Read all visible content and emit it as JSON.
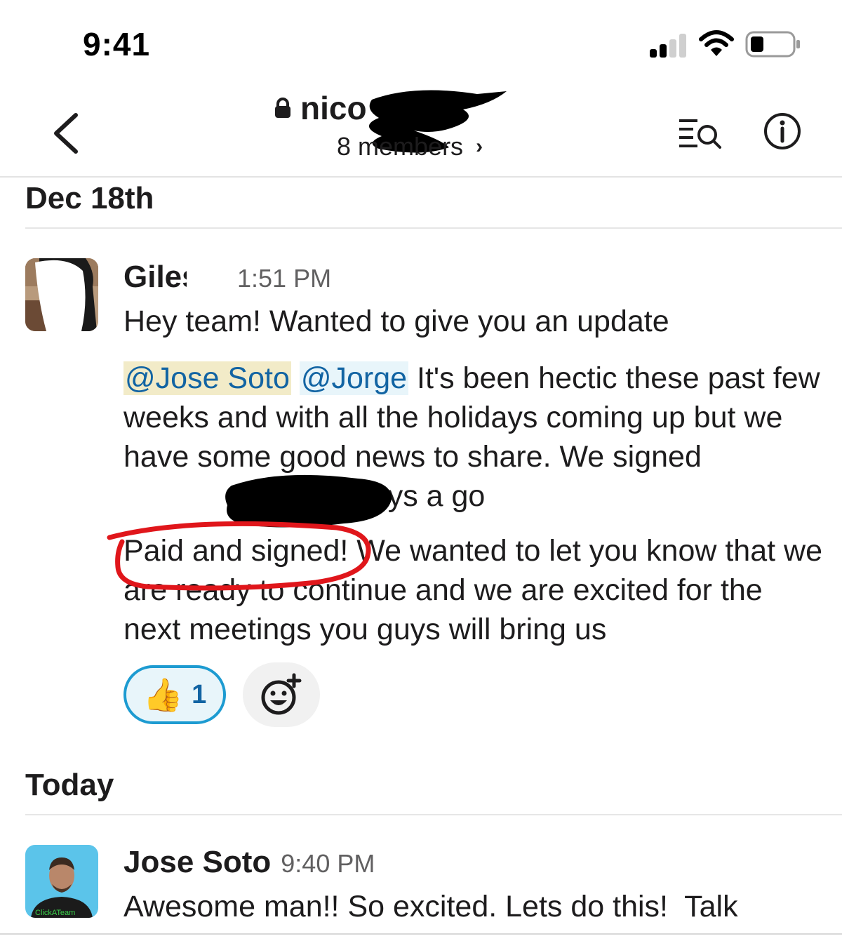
{
  "status_bar": {
    "time": "9:41"
  },
  "header": {
    "channel_name": "nico",
    "members_label": "8 members",
    "members_chevron": "›"
  },
  "sections": {
    "first_date": "Dec 18th",
    "second_date": "Today"
  },
  "messages": [
    {
      "author": "Giles",
      "time": "1:51 PM",
      "line1": "Hey team! Wanted to give you an update",
      "mention1": "@Jose Soto",
      "mention2": "@Jorge",
      "para2_after_mentions": " It's been hectic these past few weeks and with all the holidays coming up but we have some good news to share. We signed ",
      "para2_end": "two days a go",
      "para3": "Paid and signed! We wanted to let you know that we are ready to continue and we are excited for the next meetings you guys will bring us",
      "reaction_emoji": "👍",
      "reaction_count": "1"
    },
    {
      "author": "Jose Soto",
      "time": "9:40 PM",
      "text": "Awesome man!! So excited. Lets do this!  Talk",
      "avatar_shirt_text": "ClickATeam"
    }
  ],
  "colors": {
    "mention_text": "#1264a3",
    "reaction_border": "#1d9bd1",
    "annotation_circle": "#e0161b"
  },
  "icons": [
    "chevron-left-icon",
    "lock-icon",
    "search-icon",
    "info-icon",
    "thumbs-up-icon",
    "add-reaction-icon",
    "signal-icon",
    "wifi-icon",
    "battery-icon"
  ]
}
